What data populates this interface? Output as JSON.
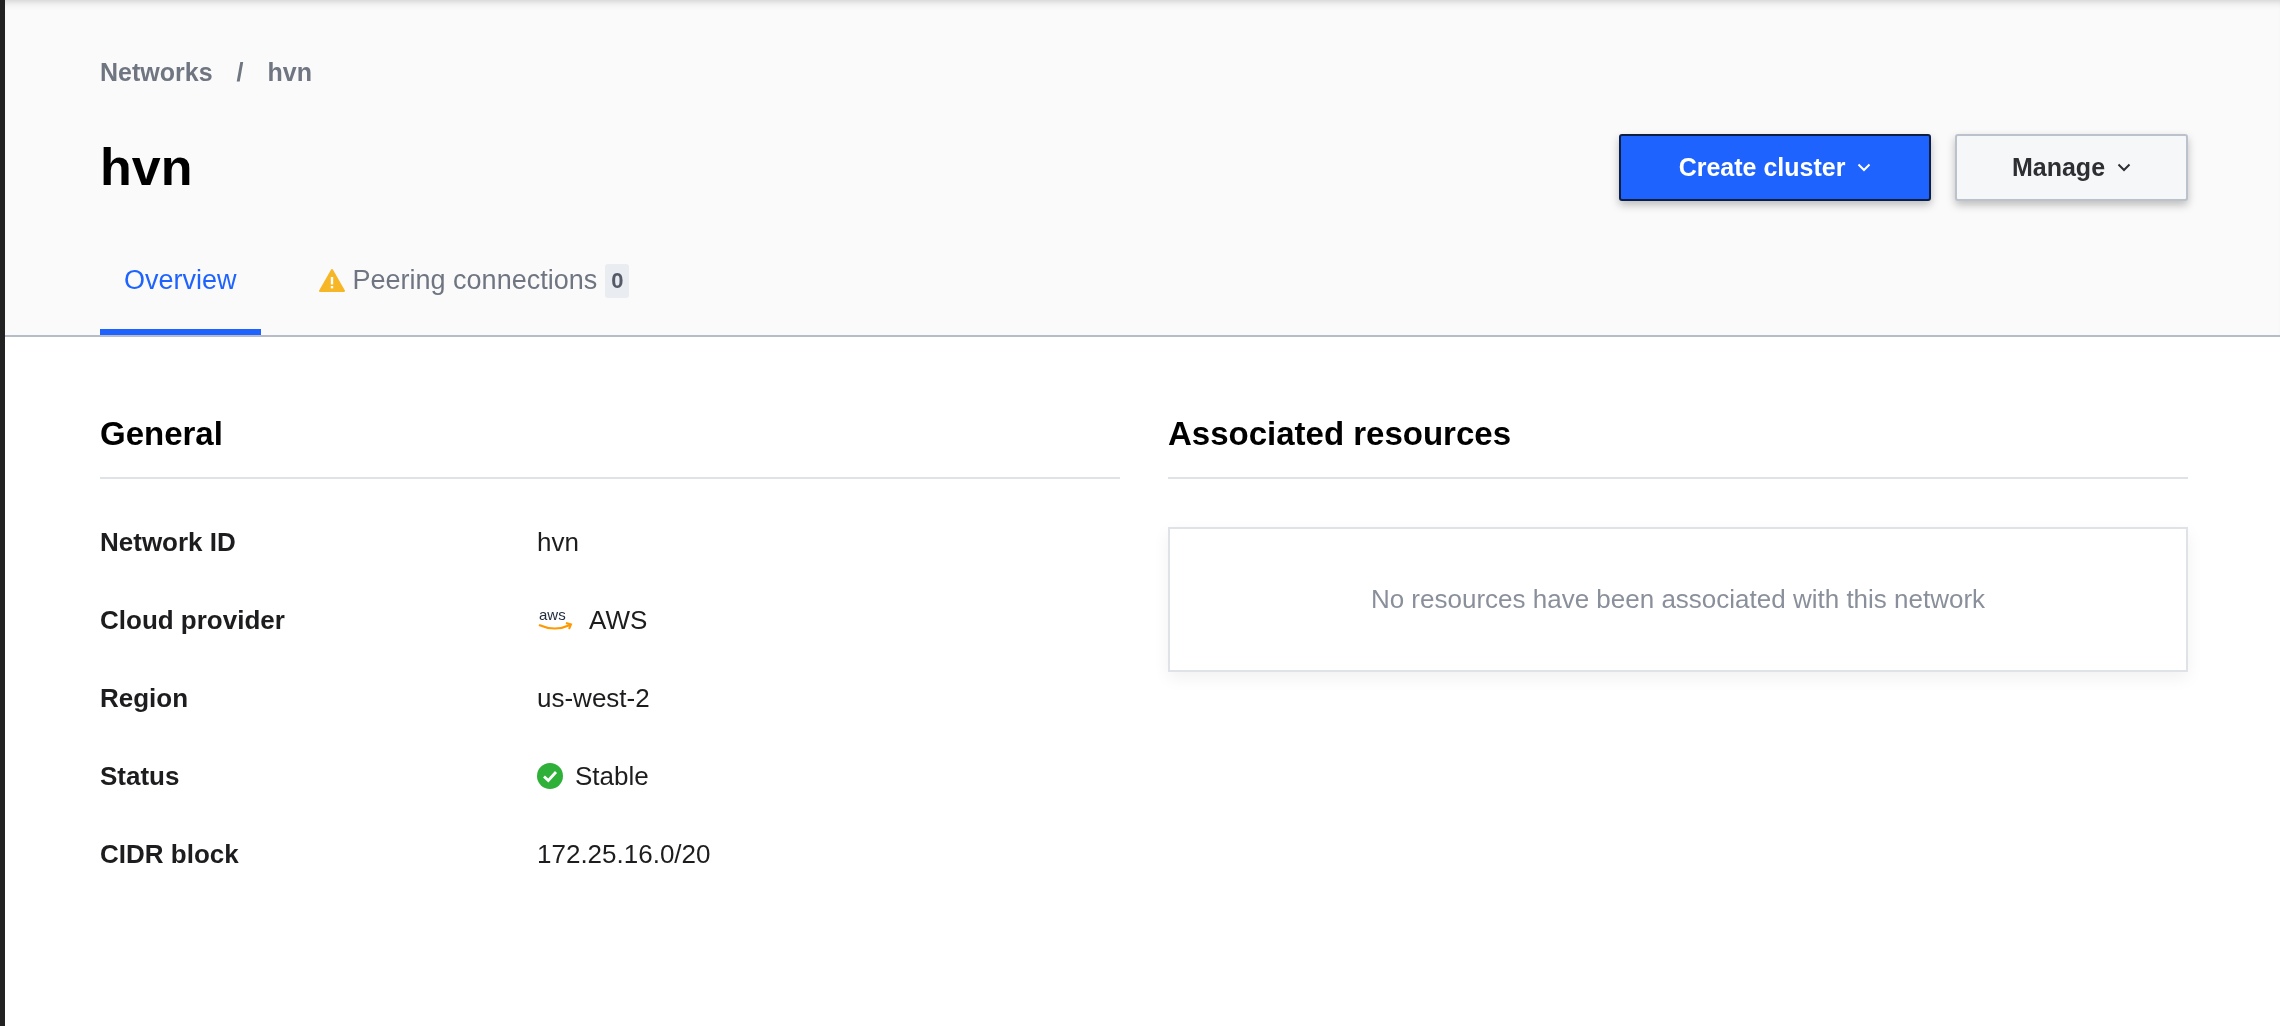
{
  "breadcrumb": [
    {
      "label": "Networks"
    },
    {
      "label": "hvn"
    }
  ],
  "breadcrumb_separator": "/",
  "title": "hvn",
  "actions": [
    {
      "label": "Create cluster",
      "kind": "primary"
    },
    {
      "label": "Manage",
      "kind": "secondary"
    }
  ],
  "tabs": [
    {
      "label": "Overview",
      "selected": true,
      "warning": false
    },
    {
      "label": "Peering connections",
      "selected": false,
      "warning": true,
      "count": "0"
    }
  ],
  "general": {
    "heading": "General",
    "rows": [
      {
        "label": "Network ID",
        "value": "hvn",
        "kind": "text"
      },
      {
        "label": "Cloud provider",
        "value": "AWS",
        "kind": "provider",
        "logo_text": "aws"
      },
      {
        "label": "Region",
        "value": "us-west-2",
        "kind": "text"
      },
      {
        "label": "Status",
        "value": "Stable",
        "kind": "status"
      },
      {
        "label": "CIDR block",
        "value": "172.25.16.0/20",
        "kind": "text"
      }
    ]
  },
  "associated_resources": {
    "heading": "Associated resources",
    "empty_message": "No resources have been associated with this network"
  }
}
